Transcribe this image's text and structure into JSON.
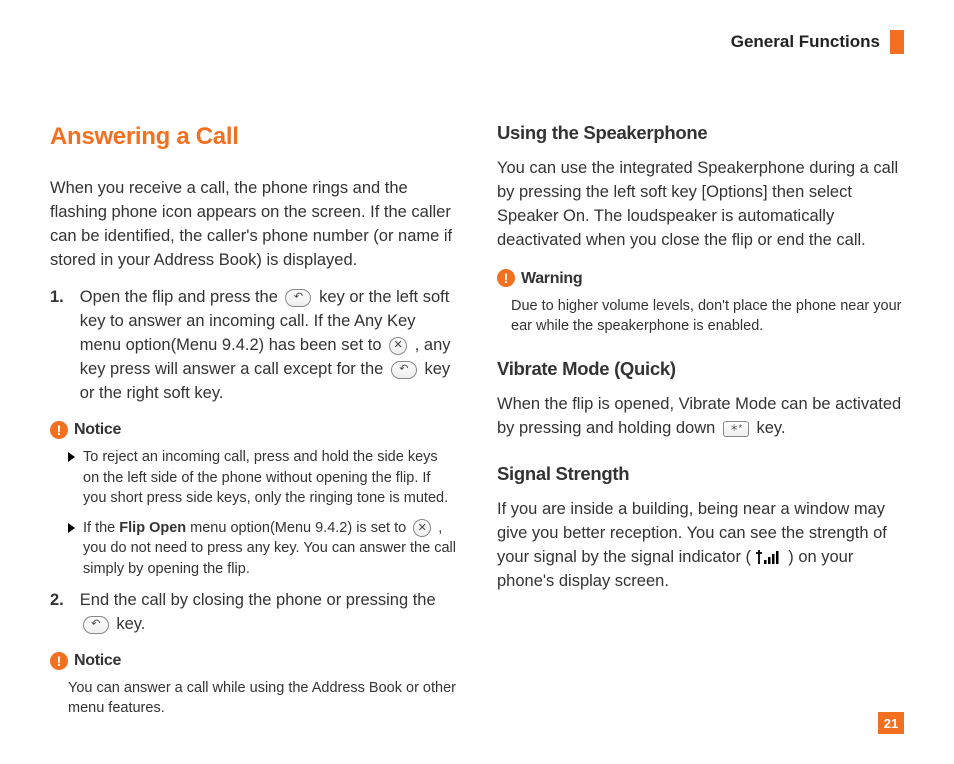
{
  "header": {
    "title": "General Functions"
  },
  "pageNumber": "21",
  "left": {
    "h2": "Answering a Call",
    "intro": "When you receive a call, the phone rings and the flashing phone icon appears on the screen. If the caller can be identified, the caller's phone number (or name if stored in your Address Book) is displayed.",
    "item1_a": "Open the flip and press the ",
    "item1_b": " key or the left soft key to answer an incoming call. If the Any Key menu option(Menu 9.4.2) has been set to ",
    "item1_c": " , any key press will answer a call except for the ",
    "item1_d": " key or the right soft key.",
    "notice1_label": "Notice",
    "notice1_b1": "To reject an incoming call, press and hold the side keys on the left side of the phone without opening the flip. If you short press side keys, only the ringing tone is muted.",
    "notice1_b2_a": "If the ",
    "notice1_b2_bold": "Flip Open",
    "notice1_b2_b": " menu option(Menu 9.4.2) is set to ",
    "notice1_b2_c": " , you do not need to press any key. You can answer the call simply by opening the flip.",
    "item2_a": "End the call by closing the phone or pressing the ",
    "item2_b": " key.",
    "notice2_label": "Notice",
    "notice2_text": "You can answer a call while using the Address Book or other menu features."
  },
  "right": {
    "speaker_h": "Using the Speakerphone",
    "speaker_p": "You can use the integrated Speakerphone during a call by pressing the left soft key [Options] then select Speaker On. The loudspeaker is automatically deactivated when you close the flip or end the call.",
    "warning_label": "Warning",
    "warning_text": "Due to higher volume levels, don't place the phone near your ear while the speakerphone is enabled.",
    "vibrate_h": "Vibrate Mode (Quick)",
    "vibrate_a": "When the flip is opened, Vibrate Mode can be activated by pressing and holding down ",
    "vibrate_b": " key.",
    "signal_h": "Signal Strength",
    "signal_a": "If you are inside a building, being near a window may give you better reception. You can see the strength of your signal by the signal indicator ( ",
    "signal_b": " ) on your phone's display screen."
  },
  "icons": {
    "send": "↶",
    "x": "✕",
    "star": "＊*",
    "signal": "📶"
  }
}
